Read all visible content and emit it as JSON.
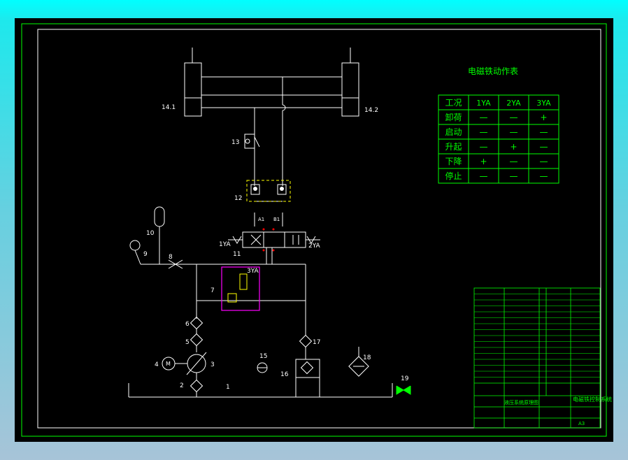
{
  "colors": {
    "background_outer": "#00ffff",
    "canvas": "#000000",
    "line": "#ffffff",
    "border": "#00ff00",
    "table": "#00ff00",
    "valve_block": "#ffff00",
    "solenoid_block": "#ff00ff",
    "port_marks": "#ff0000"
  },
  "labels": {
    "cyl_left": "14.1",
    "cyl_right": "14.2",
    "n13": "13",
    "n12": "12",
    "n11": "11",
    "n10": "10",
    "n9": "9",
    "n8": "8",
    "n7": "7",
    "n6": "6",
    "n5": "5",
    "n4": "4",
    "n3": "3",
    "n2": "2",
    "n1": "1",
    "n15": "15",
    "n16": "16",
    "n17": "17",
    "n18": "18",
    "n19": "19",
    "sol_1ya": "1YA",
    "sol_2ya": "2YA",
    "sol_3ya": "3YA",
    "motor": "M",
    "port_a": "A1",
    "port_b": "B1"
  },
  "action_table": {
    "title": "电磁铁动作表",
    "headers": [
      "工况",
      "1YA",
      "2YA",
      "3YA"
    ],
    "rows": [
      [
        "卸荷",
        "—",
        "—",
        "+"
      ],
      [
        "启动",
        "—",
        "—",
        "—"
      ],
      [
        "升起",
        "—",
        "+",
        "—"
      ],
      [
        "下降",
        "+",
        "—",
        "—"
      ],
      [
        "停止",
        "—",
        "—",
        "—"
      ]
    ]
  },
  "title_block": {
    "drawing_name": "液压系统原理图",
    "note": "电磁铁控制系统",
    "format": "A3"
  }
}
